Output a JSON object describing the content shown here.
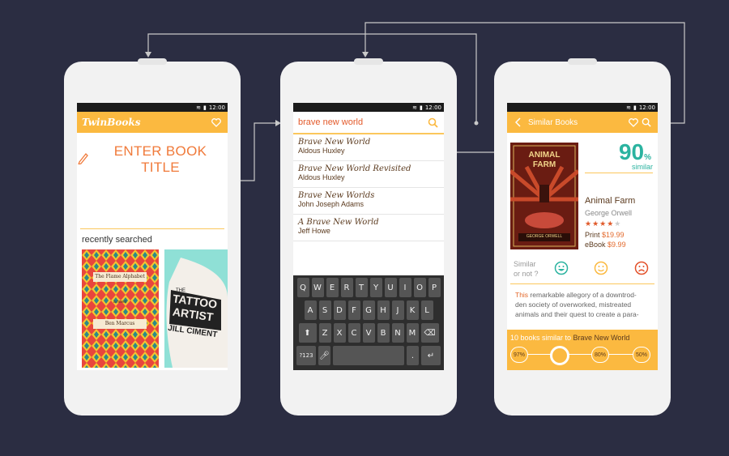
{
  "status": {
    "time": "12:00"
  },
  "screen1": {
    "app_title": "TwinBooks",
    "enter_label": "ENTER BOOK TITLE",
    "recent_label": "recently searched",
    "cover1": {
      "title": "The Flame Alphabet",
      "subtitle": "a novel",
      "author": "Ben Marcus"
    },
    "cover2": {
      "title_top": "THE",
      "title_line1": "TATTOO",
      "title_line2": "ARTIST",
      "author": "JILL CIMENT"
    }
  },
  "screen2": {
    "query": "brave new world",
    "results": [
      {
        "title": "Brave New World",
        "author": "Aldous Huxley"
      },
      {
        "title": "Brave New World Revisited",
        "author": "Aldous Huxley"
      },
      {
        "title": "Brave New Worlds",
        "author": "John Joseph Adams"
      },
      {
        "title": "A Brave New World",
        "author": "Jeff Howe"
      }
    ],
    "keyboard": {
      "row1": [
        "Q",
        "W",
        "E",
        "R",
        "T",
        "Y",
        "U",
        "I",
        "O",
        "P"
      ],
      "row2": [
        "A",
        "S",
        "D",
        "F",
        "G",
        "H",
        "J",
        "K",
        "L"
      ],
      "row3": [
        "Z",
        "X",
        "C",
        "V",
        "B",
        "N",
        "M"
      ],
      "sym_key": "?123",
      "period_key": "."
    }
  },
  "screen3": {
    "title": "Similar Books",
    "percent": "90",
    "percent_sign": "%",
    "similar_word": "similar",
    "cover_title_1": "ANIMAL",
    "cover_title_2": "FARM",
    "cover_author": "GEORGE ORWELL",
    "book_title": "Animal Farm",
    "book_author": "George Orwell",
    "rating": 4,
    "rating_max": 5,
    "stars_on": "★★★★",
    "stars_off": "★",
    "print_label": "Print",
    "print_price": "$19.99",
    "ebook_label": "eBook",
    "ebook_price": "$9.99",
    "similar_q_line1": "Similar",
    "similar_q_line2": "or not ?",
    "desc_highlight": "This",
    "desc_line1": " remarkable allegory of a downtrod-",
    "desc_line2": "den society of overworked, mistreated",
    "desc_line3": "animals and their quest to create a para-",
    "count": "10",
    "count_text": " books similar to ",
    "count_book": "Brave New World",
    "slider": [
      "97%",
      "80%",
      "50%"
    ]
  },
  "colors": {
    "background": "#2b2d42",
    "accent": "#fbb940",
    "orange": "#f07a3a",
    "teal": "#2bb3a0"
  }
}
